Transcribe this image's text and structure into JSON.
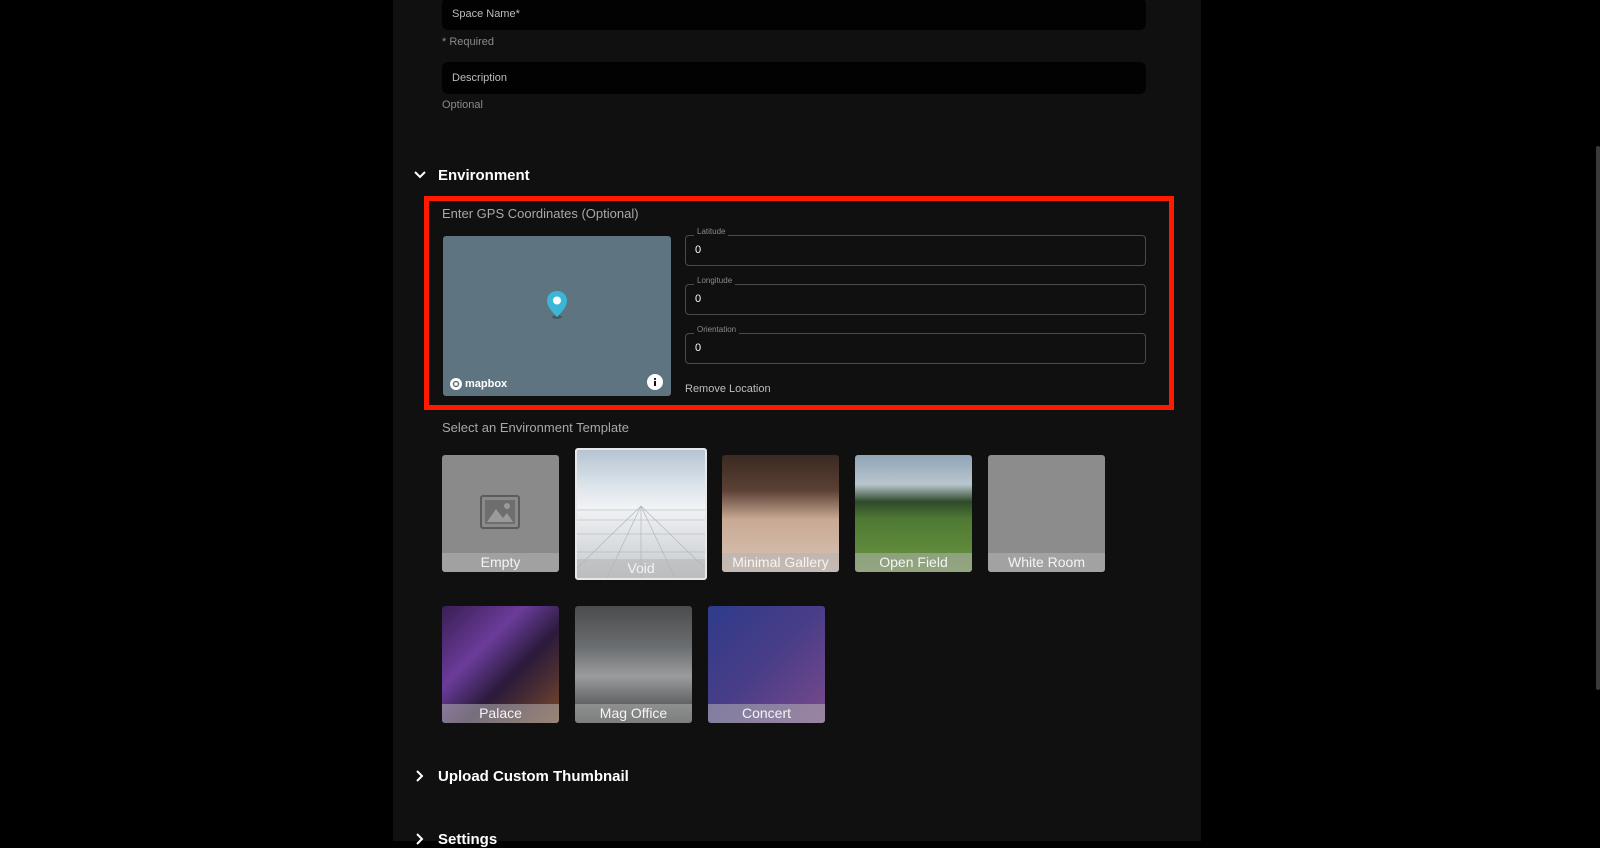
{
  "form": {
    "space_name_placeholder": "Space Name*",
    "space_name_helper": "* Required",
    "description_placeholder": "Description",
    "description_helper": "Optional"
  },
  "environment": {
    "title": "Environment",
    "gps_label": "Enter GPS Coordinates (Optional)",
    "map": {
      "brand": "mapbox"
    },
    "latitude": {
      "label": "Latitude",
      "value": "0"
    },
    "longitude": {
      "label": "Longitude",
      "value": "0"
    },
    "orientation": {
      "label": "Orientation",
      "value": "0"
    },
    "remove_location": "Remove Location",
    "template_label": "Select an Environment Template",
    "templates": [
      {
        "name": "Empty"
      },
      {
        "name": "Void",
        "selected": true
      },
      {
        "name": "Minimal Gallery"
      },
      {
        "name": "Open Field"
      },
      {
        "name": "White Room"
      },
      {
        "name": "Palace"
      },
      {
        "name": "Mag Office"
      },
      {
        "name": "Concert"
      }
    ]
  },
  "upload_thumbnail": {
    "title": "Upload Custom Thumbnail"
  },
  "settings": {
    "title": "Settings"
  },
  "colors": {
    "highlight": "#ff1a00",
    "pin": "#3bb6d6",
    "panel": "#101010"
  }
}
